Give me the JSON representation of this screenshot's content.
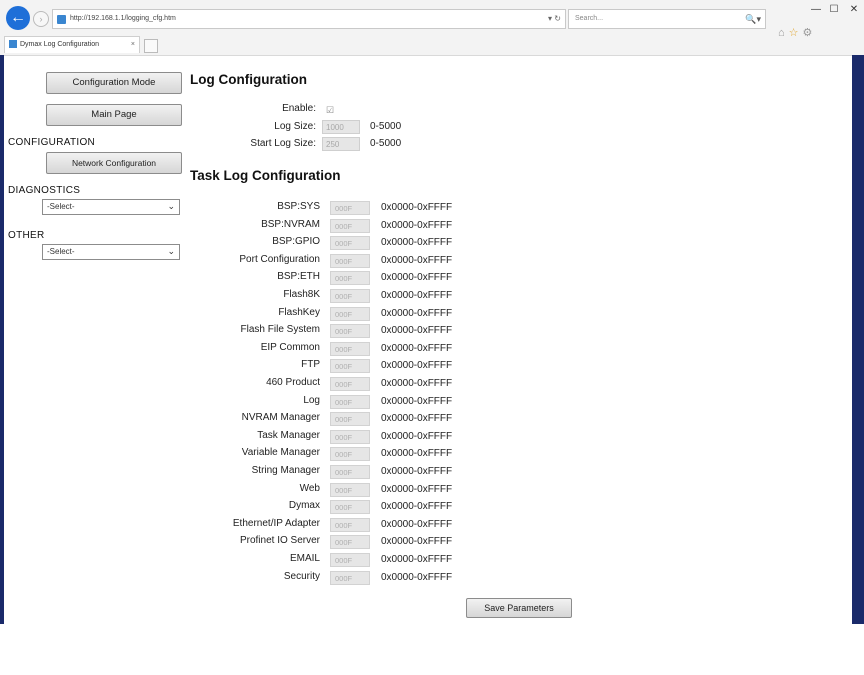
{
  "browser": {
    "url": "http://192.168.1.1/logging_cfg.htm",
    "search_placeholder": "Search...",
    "tab_title": "Dymax Log Configuration",
    "tab_close": "×",
    "back_glyph": "←",
    "reload_glyph": "▾ ↻",
    "search_glyph": "🔍▾",
    "minimize": "—",
    "maximize": "☐",
    "close": "✕"
  },
  "sidebar": {
    "config_mode_label": "Configuration Mode",
    "main_page_label": "Main Page",
    "configuration_heading": "CONFIGURATION",
    "network_config_label": "Network Configuration",
    "diagnostics_heading": "DIAGNOSTICS",
    "diagnostics_select": "-Select-",
    "other_heading": "OTHER",
    "other_select": "-Select-"
  },
  "log_config": {
    "title": "Log Configuration",
    "enable_label": "Enable:",
    "enable_checked": "☑",
    "log_size_label": "Log Size:",
    "log_size_value": "1000",
    "log_size_range": "0-5000",
    "start_log_size_label": "Start Log Size:",
    "start_log_size_value": "250",
    "start_log_size_range": "0-5000"
  },
  "task_log": {
    "title": "Task Log Configuration",
    "rows": [
      {
        "label": "BSP:SYS",
        "value": "000F",
        "range": "0x0000-0xFFFF"
      },
      {
        "label": "BSP:NVRAM",
        "value": "000F",
        "range": "0x0000-0xFFFF"
      },
      {
        "label": "BSP:GPIO",
        "value": "000F",
        "range": "0x0000-0xFFFF"
      },
      {
        "label": "Port Configuration",
        "value": "000F",
        "range": "0x0000-0xFFFF"
      },
      {
        "label": "BSP:ETH",
        "value": "000F",
        "range": "0x0000-0xFFFF"
      },
      {
        "label": "Flash8K",
        "value": "000F",
        "range": "0x0000-0xFFFF"
      },
      {
        "label": "FlashKey",
        "value": "000F",
        "range": "0x0000-0xFFFF"
      },
      {
        "label": "Flash File System",
        "value": "000F",
        "range": "0x0000-0xFFFF"
      },
      {
        "label": "EIP Common",
        "value": "000F",
        "range": "0x0000-0xFFFF"
      },
      {
        "label": "FTP",
        "value": "000F",
        "range": "0x0000-0xFFFF"
      },
      {
        "label": "460 Product",
        "value": "000F",
        "range": "0x0000-0xFFFF"
      },
      {
        "label": "Log",
        "value": "000F",
        "range": "0x0000-0xFFFF"
      },
      {
        "label": "NVRAM Manager",
        "value": "000F",
        "range": "0x0000-0xFFFF"
      },
      {
        "label": "Task Manager",
        "value": "000F",
        "range": "0x0000-0xFFFF"
      },
      {
        "label": "Variable Manager",
        "value": "000F",
        "range": "0x0000-0xFFFF"
      },
      {
        "label": "String Manager",
        "value": "000F",
        "range": "0x0000-0xFFFF"
      },
      {
        "label": "Web",
        "value": "000F",
        "range": "0x0000-0xFFFF"
      },
      {
        "label": "Dymax",
        "value": "000F",
        "range": "0x0000-0xFFFF"
      },
      {
        "label": "Ethernet/IP Adapter",
        "value": "000F",
        "range": "0x0000-0xFFFF"
      },
      {
        "label": "Profinet IO Server",
        "value": "000F",
        "range": "0x0000-0xFFFF"
      },
      {
        "label": "EMAIL",
        "value": "000F",
        "range": "0x0000-0xFFFF"
      },
      {
        "label": "Security",
        "value": "000F",
        "range": "0x0000-0xFFFF"
      }
    ]
  },
  "save_label": "Save Parameters",
  "colors": {
    "frame": "#1a2a6a",
    "accent": "#1e6fd8"
  }
}
